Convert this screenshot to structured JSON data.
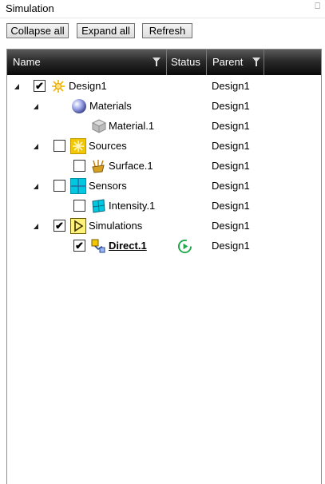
{
  "window": {
    "title": "Simulation",
    "pin_glyph": "⎕"
  },
  "toolbar": {
    "collapse_label": "Collapse all",
    "expand_label": "Expand all",
    "refresh_label": "Refresh"
  },
  "columns": {
    "name": "Name",
    "status": "Status",
    "parent": "Parent"
  },
  "rows": [
    {
      "name": "Design1",
      "parent": "Design1",
      "checked": true,
      "icon": "design-icon",
      "expander": true
    },
    {
      "name": "Materials",
      "parent": "Design1",
      "icon": "materials-icon",
      "expander": true
    },
    {
      "name": "Material.1",
      "parent": "Design1",
      "icon": "material-icon"
    },
    {
      "name": "Sources",
      "parent": "Design1",
      "checked": false,
      "icon": "sources-icon",
      "expander": true
    },
    {
      "name": "Surface.1",
      "parent": "Design1",
      "checked": false,
      "icon": "surface-source-icon"
    },
    {
      "name": "Sensors",
      "parent": "Design1",
      "checked": false,
      "icon": "sensors-icon",
      "expander": true
    },
    {
      "name": "Intensity.1",
      "parent": "Design1",
      "checked": false,
      "icon": "intensity-sensor-icon"
    },
    {
      "name": "Simulations",
      "parent": "Design1",
      "checked": true,
      "icon": "simulations-icon",
      "expander": true
    },
    {
      "name": "Direct.1",
      "parent": "Design1",
      "checked": true,
      "icon": "direct-simulation-icon",
      "status": "run-status-icon",
      "selected": true
    }
  ],
  "checkmark": "✔",
  "colors": {
    "header_dark": "#0a0a0a",
    "sources_yellow": "#f2c600",
    "sensors_cyan": "#00c8e0",
    "status_green": "#1fa84a"
  }
}
